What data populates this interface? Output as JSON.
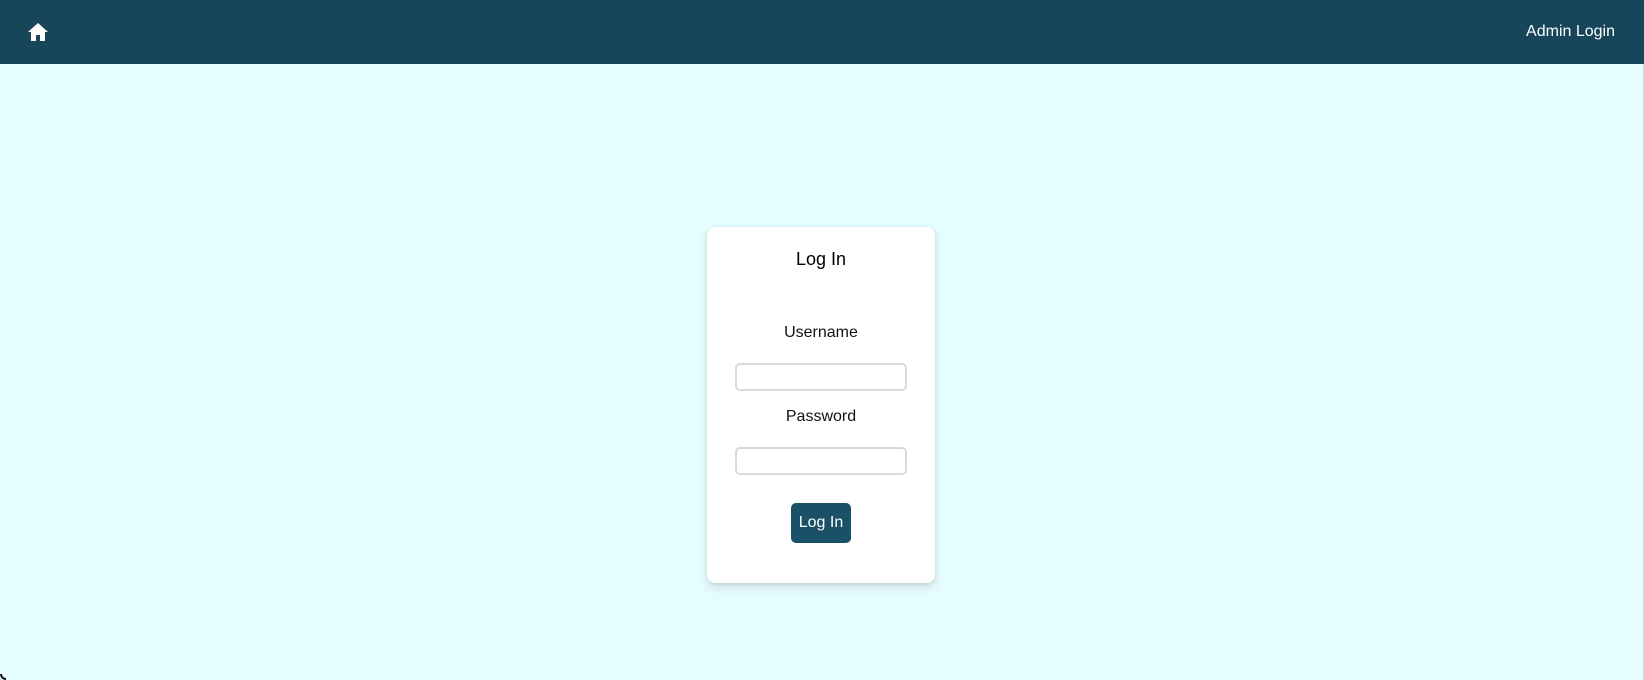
{
  "header": {
    "home_icon": "home-icon",
    "admin_login_label": "Admin Login",
    "background_color": "#174559"
  },
  "login_card": {
    "title": "Log In",
    "username_label": "Username",
    "username_value": "",
    "password_label": "Password",
    "password_value": "",
    "submit_label": "Log In",
    "button_color": "#1a5168"
  },
  "page": {
    "background_color": "#e6fdff"
  }
}
